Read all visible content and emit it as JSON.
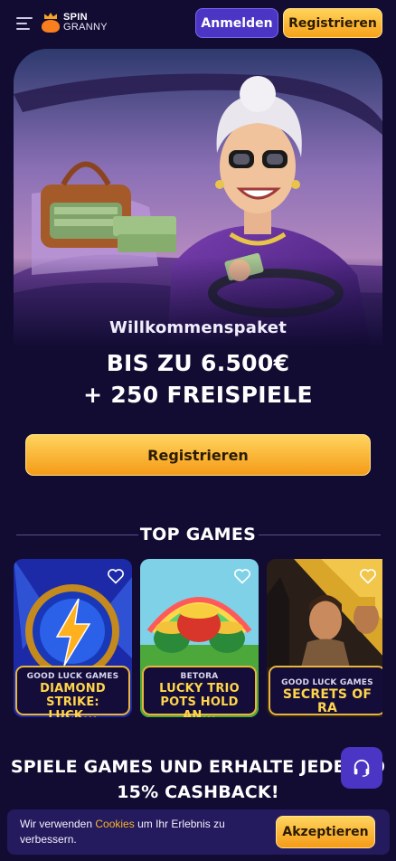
{
  "header": {
    "logo_line1": "SPIN",
    "logo_line2": "GRANNY",
    "login_label": "Anmelden",
    "register_label": "Registrieren"
  },
  "promo": {
    "subtitle": "Willkommenspaket",
    "title_line1": "BIS ZU 6.500€",
    "title_line2": "+ 250 FREISPIELE",
    "register_label": "Registrieren"
  },
  "top_games": {
    "title": "TOP GAMES",
    "games": [
      {
        "provider": "GOOD LUCK GAMES",
        "name": "DIAMOND STRIKE: LUCK...",
        "favorite_icon": "heart-outline-icon"
      },
      {
        "provider": "BETORA",
        "name": "LUCKY TRIO POTS HOLD AN...",
        "favorite_icon": "heart-outline-icon"
      },
      {
        "provider": "GOOD LUCK GAMES",
        "name": "SECRETS OF RA",
        "favorite_icon": "heart-outline-icon"
      }
    ]
  },
  "cashback": {
    "line1": "SPIELE GAMES UND ERHALTE JEDE WO",
    "line2": "15% CASHBACK!"
  },
  "cookie": {
    "text_before": "Wir verwenden ",
    "link": "Cookies",
    "text_after": " um Ihr Erlebnis zu verbessern.",
    "accept_label": "Akzeptieren"
  },
  "colors": {
    "background": "#120c33",
    "accent_orange": "#f7a21a",
    "accent_purple": "#4a35c4",
    "gold_border": "#e9b53c"
  }
}
